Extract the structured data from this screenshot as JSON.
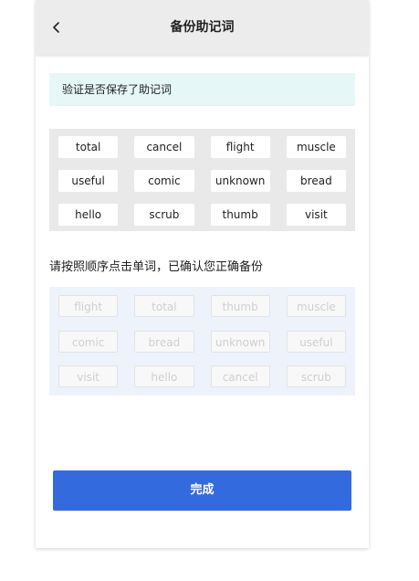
{
  "header": {
    "title": "备份助记词",
    "back_icon": "chevron-left-icon"
  },
  "notice": {
    "text": "验证是否保存了助记词"
  },
  "mnemonic_words": [
    "total",
    "cancel",
    "flight",
    "muscle",
    "useful",
    "comic",
    "unknown",
    "bread",
    "hello",
    "scrub",
    "thumb",
    "visit"
  ],
  "instruction": "请按照顺序点击单词，已确认您正确备份",
  "shuffled_words": [
    "flight",
    "total",
    "thumb",
    "muscle",
    "comic",
    "bread",
    "unknown",
    "useful",
    "visit",
    "hello",
    "cancel",
    "scrub"
  ],
  "done_button": {
    "label": "完成"
  },
  "colors": {
    "accent": "#336bde",
    "notice_bg": "#e5f7f6",
    "header_bg": "#ececec"
  }
}
